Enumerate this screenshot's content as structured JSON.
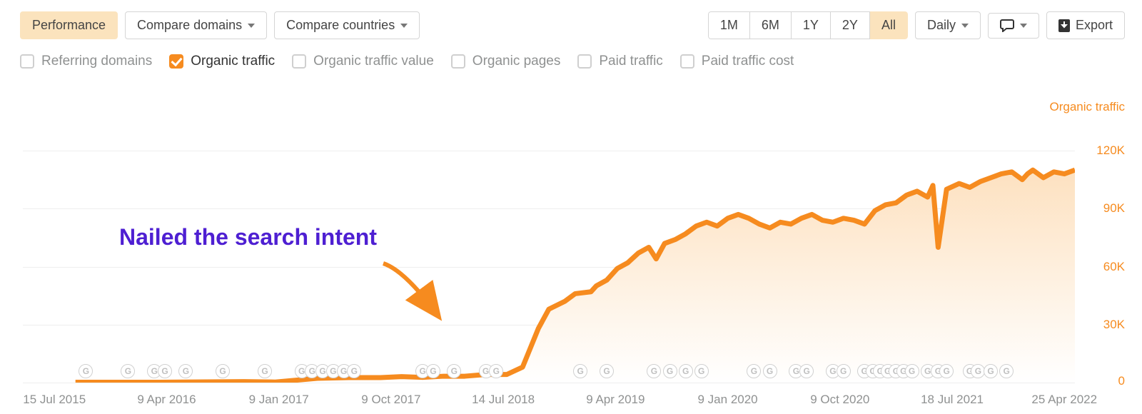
{
  "tabs": {
    "performance": "Performance",
    "compare_domains": "Compare domains",
    "compare_countries": "Compare countries"
  },
  "range": {
    "options": [
      "1M",
      "6M",
      "1Y",
      "2Y",
      "All"
    ],
    "active": 4
  },
  "granularity": {
    "label": "Daily"
  },
  "notes": {
    "label": ""
  },
  "export": {
    "label": "Export"
  },
  "metrics": [
    {
      "id": "referring-domains",
      "label": "Referring domains",
      "on": false
    },
    {
      "id": "organic-traffic",
      "label": "Organic traffic",
      "on": true
    },
    {
      "id": "organic-traffic-value",
      "label": "Organic traffic value",
      "on": false
    },
    {
      "id": "organic-pages",
      "label": "Organic pages",
      "on": false
    },
    {
      "id": "paid-traffic",
      "label": "Paid traffic",
      "on": false
    },
    {
      "id": "paid-traffic-cost",
      "label": "Paid traffic cost",
      "on": false
    }
  ],
  "annotation": {
    "text": "Nailed the search intent"
  },
  "chart_data": {
    "type": "area",
    "title": "Organic traffic",
    "ylabel": "Organic traffic",
    "ylim": [
      0,
      130000
    ],
    "y_ticks": [
      0,
      30000,
      60000,
      90000,
      120000
    ],
    "y_tick_labels": [
      "0",
      "30K",
      "60K",
      "90K",
      "120K"
    ],
    "x_ticks": [
      "15 Jul 2015",
      "9 Apr 2016",
      "9 Jan 2017",
      "9 Oct 2017",
      "14 Jul 2018",
      "9 Apr 2019",
      "9 Jan 2020",
      "9 Oct 2020",
      "18 Jul 2021",
      "25 Apr 2022"
    ],
    "series": [
      {
        "name": "Organic traffic",
        "color": "#f68b1f",
        "points": [
          {
            "x": 0.05,
            "y": 200
          },
          {
            "x": 0.13,
            "y": 200
          },
          {
            "x": 0.21,
            "y": 500
          },
          {
            "x": 0.24,
            "y": 300
          },
          {
            "x": 0.28,
            "y": 2200
          },
          {
            "x": 0.31,
            "y": 2600
          },
          {
            "x": 0.34,
            "y": 2600
          },
          {
            "x": 0.36,
            "y": 3100
          },
          {
            "x": 0.38,
            "y": 2700
          },
          {
            "x": 0.4,
            "y": 3300
          },
          {
            "x": 0.42,
            "y": 3300
          },
          {
            "x": 0.44,
            "y": 4200
          },
          {
            "x": 0.46,
            "y": 4200
          },
          {
            "x": 0.475,
            "y": 8000
          },
          {
            "x": 0.49,
            "y": 28000
          },
          {
            "x": 0.5,
            "y": 38000
          },
          {
            "x": 0.515,
            "y": 42000
          },
          {
            "x": 0.525,
            "y": 46000
          },
          {
            "x": 0.54,
            "y": 47000
          },
          {
            "x": 0.545,
            "y": 50000
          },
          {
            "x": 0.555,
            "y": 53000
          },
          {
            "x": 0.565,
            "y": 59000
          },
          {
            "x": 0.575,
            "y": 62000
          },
          {
            "x": 0.585,
            "y": 67000
          },
          {
            "x": 0.595,
            "y": 70000
          },
          {
            "x": 0.602,
            "y": 64000
          },
          {
            "x": 0.61,
            "y": 72000
          },
          {
            "x": 0.62,
            "y": 74000
          },
          {
            "x": 0.63,
            "y": 77000
          },
          {
            "x": 0.64,
            "y": 81000
          },
          {
            "x": 0.65,
            "y": 83000
          },
          {
            "x": 0.66,
            "y": 81000
          },
          {
            "x": 0.67,
            "y": 85000
          },
          {
            "x": 0.68,
            "y": 87000
          },
          {
            "x": 0.69,
            "y": 85000
          },
          {
            "x": 0.7,
            "y": 82000
          },
          {
            "x": 0.71,
            "y": 80000
          },
          {
            "x": 0.72,
            "y": 83000
          },
          {
            "x": 0.73,
            "y": 82000
          },
          {
            "x": 0.74,
            "y": 85000
          },
          {
            "x": 0.75,
            "y": 87000
          },
          {
            "x": 0.76,
            "y": 84000
          },
          {
            "x": 0.77,
            "y": 83000
          },
          {
            "x": 0.78,
            "y": 85000
          },
          {
            "x": 0.79,
            "y": 84000
          },
          {
            "x": 0.8,
            "y": 82000
          },
          {
            "x": 0.81,
            "y": 89000
          },
          {
            "x": 0.82,
            "y": 92000
          },
          {
            "x": 0.83,
            "y": 93000
          },
          {
            "x": 0.84,
            "y": 97000
          },
          {
            "x": 0.85,
            "y": 99000
          },
          {
            "x": 0.86,
            "y": 96000
          },
          {
            "x": 0.865,
            "y": 102000
          },
          {
            "x": 0.87,
            "y": 70000
          },
          {
            "x": 0.878,
            "y": 100000
          },
          {
            "x": 0.89,
            "y": 103000
          },
          {
            "x": 0.9,
            "y": 101000
          },
          {
            "x": 0.91,
            "y": 104000
          },
          {
            "x": 0.92,
            "y": 106000
          },
          {
            "x": 0.93,
            "y": 108000
          },
          {
            "x": 0.94,
            "y": 109000
          },
          {
            "x": 0.95,
            "y": 105000
          },
          {
            "x": 0.955,
            "y": 108000
          },
          {
            "x": 0.96,
            "y": 110000
          },
          {
            "x": 0.97,
            "y": 106000
          },
          {
            "x": 0.98,
            "y": 109000
          },
          {
            "x": 0.99,
            "y": 108000
          },
          {
            "x": 1.0,
            "y": 110000
          }
        ]
      }
    ],
    "google_markers_x": [
      0.06,
      0.1,
      0.125,
      0.135,
      0.155,
      0.19,
      0.23,
      0.265,
      0.275,
      0.285,
      0.295,
      0.305,
      0.315,
      0.38,
      0.39,
      0.41,
      0.44,
      0.45,
      0.53,
      0.555,
      0.6,
      0.615,
      0.63,
      0.645,
      0.695,
      0.71,
      0.735,
      0.745,
      0.77,
      0.78,
      0.8,
      0.808,
      0.815,
      0.822,
      0.83,
      0.837,
      0.845,
      0.86,
      0.87,
      0.878,
      0.9,
      0.908,
      0.92,
      0.935
    ]
  }
}
